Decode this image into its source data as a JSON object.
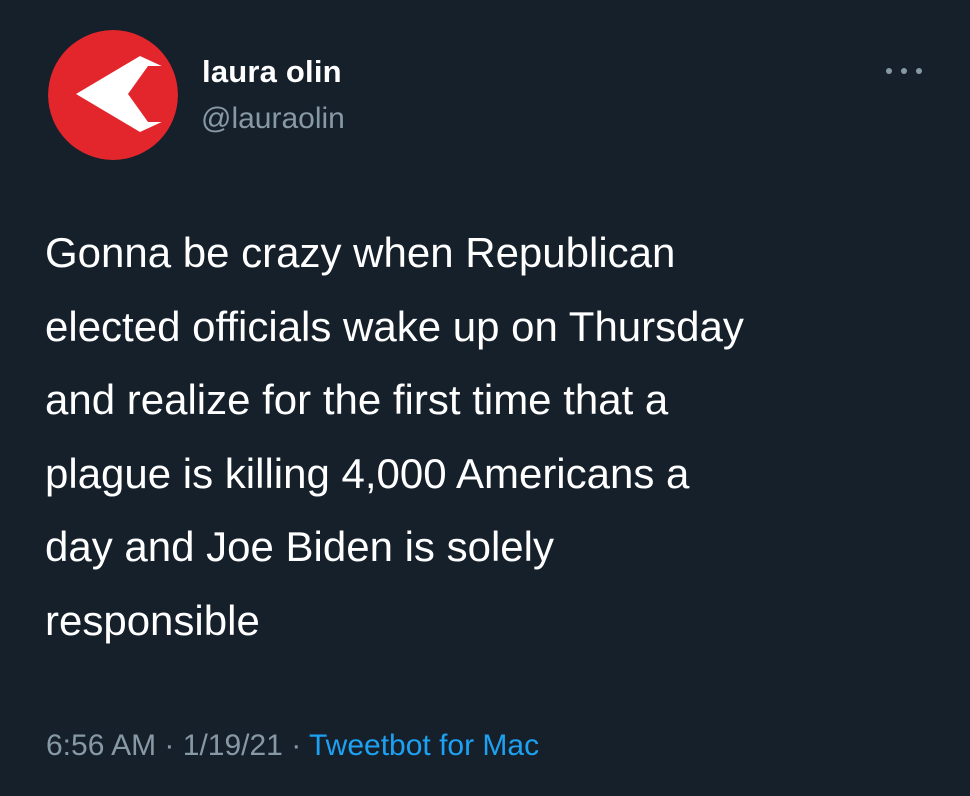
{
  "tweet": {
    "author": {
      "display_name": "laura olin",
      "handle": "@lauraolin",
      "avatar_icon": "red-arrow-logo-icon"
    },
    "more_icon": "ellipsis-icon",
    "text_lines": [
      "Gonna be crazy when Republican",
      "elected officials wake up on Thursday",
      "and realize for the first time that a",
      "plague is killing 4,000 Americans a",
      "day and Joe Biden is solely",
      "responsible"
    ],
    "meta": {
      "time": "6:56 AM",
      "separator": "·",
      "date": "1/19/21",
      "source": "Tweetbot for Mac"
    }
  },
  "colors": {
    "background": "#15202b",
    "primary_text": "#ffffff",
    "secondary_text": "#8899a6",
    "link": "#1da1f2",
    "avatar_red": "#e3262c"
  }
}
